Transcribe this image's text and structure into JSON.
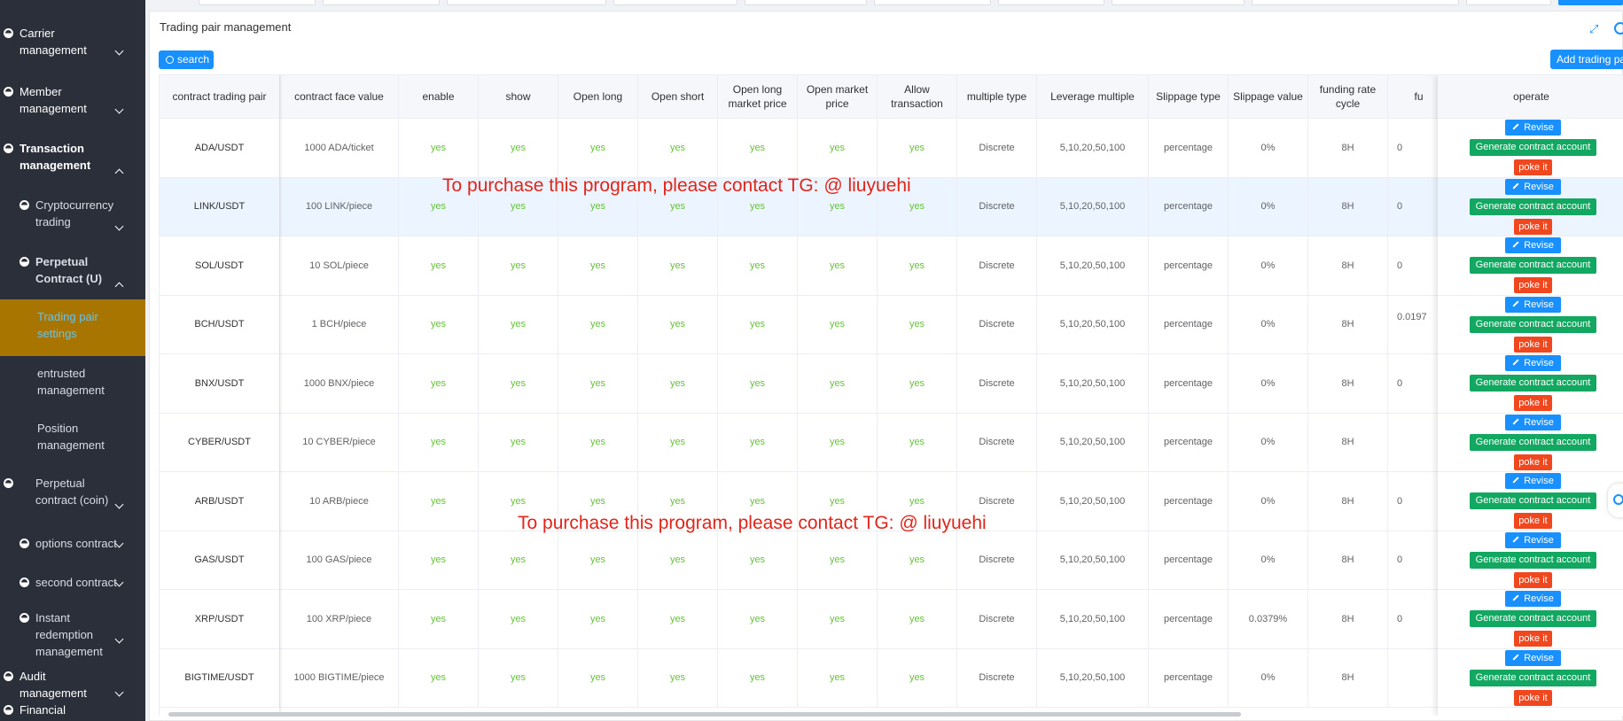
{
  "sidebar": {
    "items": [
      {
        "label": "Carrier management",
        "level": 1,
        "expanded": false
      },
      {
        "label": "Member management",
        "level": 1,
        "expanded": false
      },
      {
        "label": "Transaction management",
        "level": 1,
        "expanded": true
      },
      {
        "label": "Cryptocurrency trading",
        "level": 2,
        "expanded": false
      },
      {
        "label": "Perpetual Contract (U)",
        "level": 2,
        "expanded": true
      },
      {
        "label": "Trading pair settings",
        "level": 3,
        "active": true
      },
      {
        "label": "entrusted management",
        "level": 3
      },
      {
        "label": "Position management",
        "level": 3
      },
      {
        "label": "Perpetual contract (coin)",
        "level": 2,
        "expanded": false
      },
      {
        "label": "options contract",
        "level": 2,
        "expanded": false
      },
      {
        "label": "second contract",
        "level": 2,
        "expanded": false
      },
      {
        "label": "Instant redemption management",
        "level": 2,
        "expanded": false
      },
      {
        "label": "Audit management",
        "level": 1,
        "expanded": false
      },
      {
        "label": "Financial",
        "level": 1
      }
    ]
  },
  "panel": {
    "title": "Trading pair management",
    "search_label": "search",
    "add_label": "Add trading pair"
  },
  "table": {
    "columns": [
      "contract trading pair",
      "contract face value",
      "enable",
      "show",
      "Open long",
      "Open short",
      "Open long market price",
      "Open market price",
      "Allow transaction",
      "multiple type",
      "Leverage multiple",
      "Slippage type",
      "Slippage value",
      "funding rate cycle",
      "fu"
    ],
    "operate_header": "operate",
    "rows": [
      {
        "pair": "ADA/USDT",
        "face": "1000 ADA/ticket",
        "flags": [
          "yes",
          "yes",
          "yes",
          "yes",
          "yes",
          "yes",
          "yes"
        ],
        "mtype": "Discrete",
        "lev": "5,10,20,50,100",
        "stype": "percentage",
        "sval": "0%",
        "cycle": "8H",
        "fu": "0"
      },
      {
        "pair": "LINK/USDT",
        "face": "100 LINK/piece",
        "flags": [
          "yes",
          "yes",
          "yes",
          "yes",
          "yes",
          "yes",
          "yes"
        ],
        "mtype": "Discrete",
        "lev": "5,10,20,50,100",
        "stype": "percentage",
        "sval": "0%",
        "cycle": "8H",
        "fu": "0"
      },
      {
        "pair": "SOL/USDT",
        "face": "10 SOL/piece",
        "flags": [
          "yes",
          "yes",
          "yes",
          "yes",
          "yes",
          "yes",
          "yes"
        ],
        "mtype": "Discrete",
        "lev": "5,10,20,50,100",
        "stype": "percentage",
        "sval": "0%",
        "cycle": "8H",
        "fu": "0"
      },
      {
        "pair": "BCH/USDT",
        "face": "1 BCH/piece",
        "flags": [
          "yes",
          "yes",
          "yes",
          "yes",
          "yes",
          "yes",
          "yes"
        ],
        "mtype": "Discrete",
        "lev": "5,10,20,50,100",
        "stype": "percentage",
        "sval": "0%",
        "cycle": "8H",
        "fu": "0.0197"
      },
      {
        "pair": "BNX/USDT",
        "face": "1000 BNX/piece",
        "flags": [
          "yes",
          "yes",
          "yes",
          "yes",
          "yes",
          "yes",
          "yes"
        ],
        "mtype": "Discrete",
        "lev": "5,10,20,50,100",
        "stype": "percentage",
        "sval": "0%",
        "cycle": "8H",
        "fu": "0"
      },
      {
        "pair": "CYBER/USDT",
        "face": "10 CYBER/piece",
        "flags": [
          "yes",
          "yes",
          "yes",
          "yes",
          "yes",
          "yes",
          "yes"
        ],
        "mtype": "Discrete",
        "lev": "5,10,20,50,100",
        "stype": "percentage",
        "sval": "0%",
        "cycle": "8H",
        "fu": ""
      },
      {
        "pair": "ARB/USDT",
        "face": "10 ARB/piece",
        "flags": [
          "yes",
          "yes",
          "yes",
          "yes",
          "yes",
          "yes",
          "yes"
        ],
        "mtype": "Discrete",
        "lev": "5,10,20,50,100",
        "stype": "percentage",
        "sval": "0%",
        "cycle": "8H",
        "fu": "0"
      },
      {
        "pair": "GAS/USDT",
        "face": "100 GAS/piece",
        "flags": [
          "yes",
          "yes",
          "yes",
          "yes",
          "yes",
          "yes",
          "yes"
        ],
        "mtype": "Discrete",
        "lev": "5,10,20,50,100",
        "stype": "percentage",
        "sval": "0%",
        "cycle": "8H",
        "fu": "0"
      },
      {
        "pair": "XRP/USDT",
        "face": "100 XRP/piece",
        "flags": [
          "yes",
          "yes",
          "yes",
          "yes",
          "yes",
          "yes",
          "yes"
        ],
        "mtype": "Discrete",
        "lev": "5,10,20,50,100",
        "stype": "percentage",
        "sval": "0.0379%",
        "cycle": "8H",
        "fu": "0"
      },
      {
        "pair": "BIGTIME/USDT",
        "face": "1000 BIGTIME/piece",
        "flags": [
          "yes",
          "yes",
          "yes",
          "yes",
          "yes",
          "yes",
          "yes"
        ],
        "mtype": "Discrete",
        "lev": "5,10,20,50,100",
        "stype": "percentage",
        "sval": "0%",
        "cycle": "8H",
        "fu": ""
      }
    ],
    "actions": {
      "revise": "Revise",
      "generate": "Generate contract account",
      "poke": "poke it"
    },
    "highlight_row": 1
  },
  "watermarks": [
    "To purchase this program, please contact TG: @ liuyuehi",
    "To purchase this program, please contact TG: @ liuyuehi"
  ],
  "colors": {
    "sidebar_bg": "#2b2f3a",
    "active_leaf_bg": "#a87600",
    "primary": "#1890ff",
    "success": "#13a861",
    "danger": "#f0471f",
    "yes_text": "#67c23a",
    "watermark": "#e1251b"
  }
}
